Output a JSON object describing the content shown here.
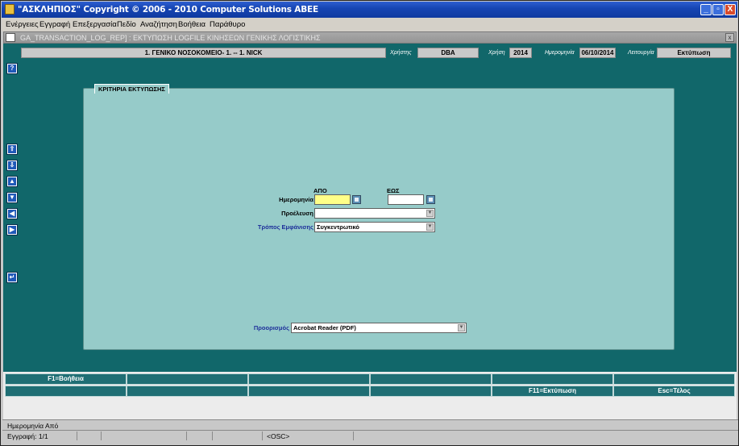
{
  "window": {
    "title": "\"ΑΣΚΛΗΠΙΟΣ\" Copyright © 2006 - 2010 Computer Solutions ΑΒΕΕ",
    "minimize": "_",
    "restore": "▫",
    "close": "X"
  },
  "menu": [
    "Ενέργειες",
    "Εγγραφή",
    "Επεξεργασία",
    "Πεδίο",
    "Αναζήτηση",
    "Βοήθεια",
    "Παράθυρο"
  ],
  "inner_window": {
    "title": "GA_TRANSACTION_LOG_REP] : ΕΚΤΥΠΩΣΗ LOGFILE ΚΙΝΗΣΕΩΝ ΓΕΝΙΚΗΣ ΛΟΓΙΣΤΙΚΗΣ",
    "close": "x"
  },
  "header": {
    "hospital": "1. ΓΕΝΙΚΟ ΝΟΣΟΚΟΜΕΙΟ- 1. -- 1. NICK",
    "user_label": "Χρήστης",
    "user": "DBA",
    "year_label": "Χρήση",
    "year": "2014",
    "date_label": "Ημερομηνία",
    "date": "06/10/2014",
    "mode_label": "Λειτουργία",
    "mode": "Εκτύπωση"
  },
  "side_buttons": {
    "help": "?",
    "first": "⇧",
    "last": "⇩",
    "prev": "▲",
    "next": "▼",
    "left": "◀",
    "right": "▶",
    "back": "↵"
  },
  "criteria": {
    "tab_label": "ΚΡΙΤΗΡΙΑ ΕΚΤΥΠΩΣΗΣ",
    "from_header": "ΑΠΟ",
    "to_header": "ΕΩΣ",
    "date_label": "Ημερομηνία",
    "date_from": "",
    "date_to": "",
    "origin_label": "Προέλευση",
    "origin_value": "",
    "display_label": "Τρόπος Εμφάνισης",
    "display_value": "Συγκεντρωτικό",
    "destination_label": "Προορισμός",
    "destination_value": "Acrobat Reader (PDF)"
  },
  "function_keys": {
    "row1": [
      "F1=Βοήθεια",
      "",
      "",
      "",
      "",
      ""
    ],
    "row2": [
      "",
      "",
      "",
      "",
      "F11=Εκτύπωση",
      "Esc=Τέλος"
    ]
  },
  "status": {
    "field_hint": "Ημερομηνία Από",
    "record": "Εγγραφή: 1/1",
    "osc": "<OSC>"
  },
  "colors": {
    "client_bg": "#11676a",
    "panel_bg": "#96cbc9",
    "required_field": "#ffff88",
    "fkey_bg": "#1f6e74",
    "titlebar": "#1746b4"
  }
}
